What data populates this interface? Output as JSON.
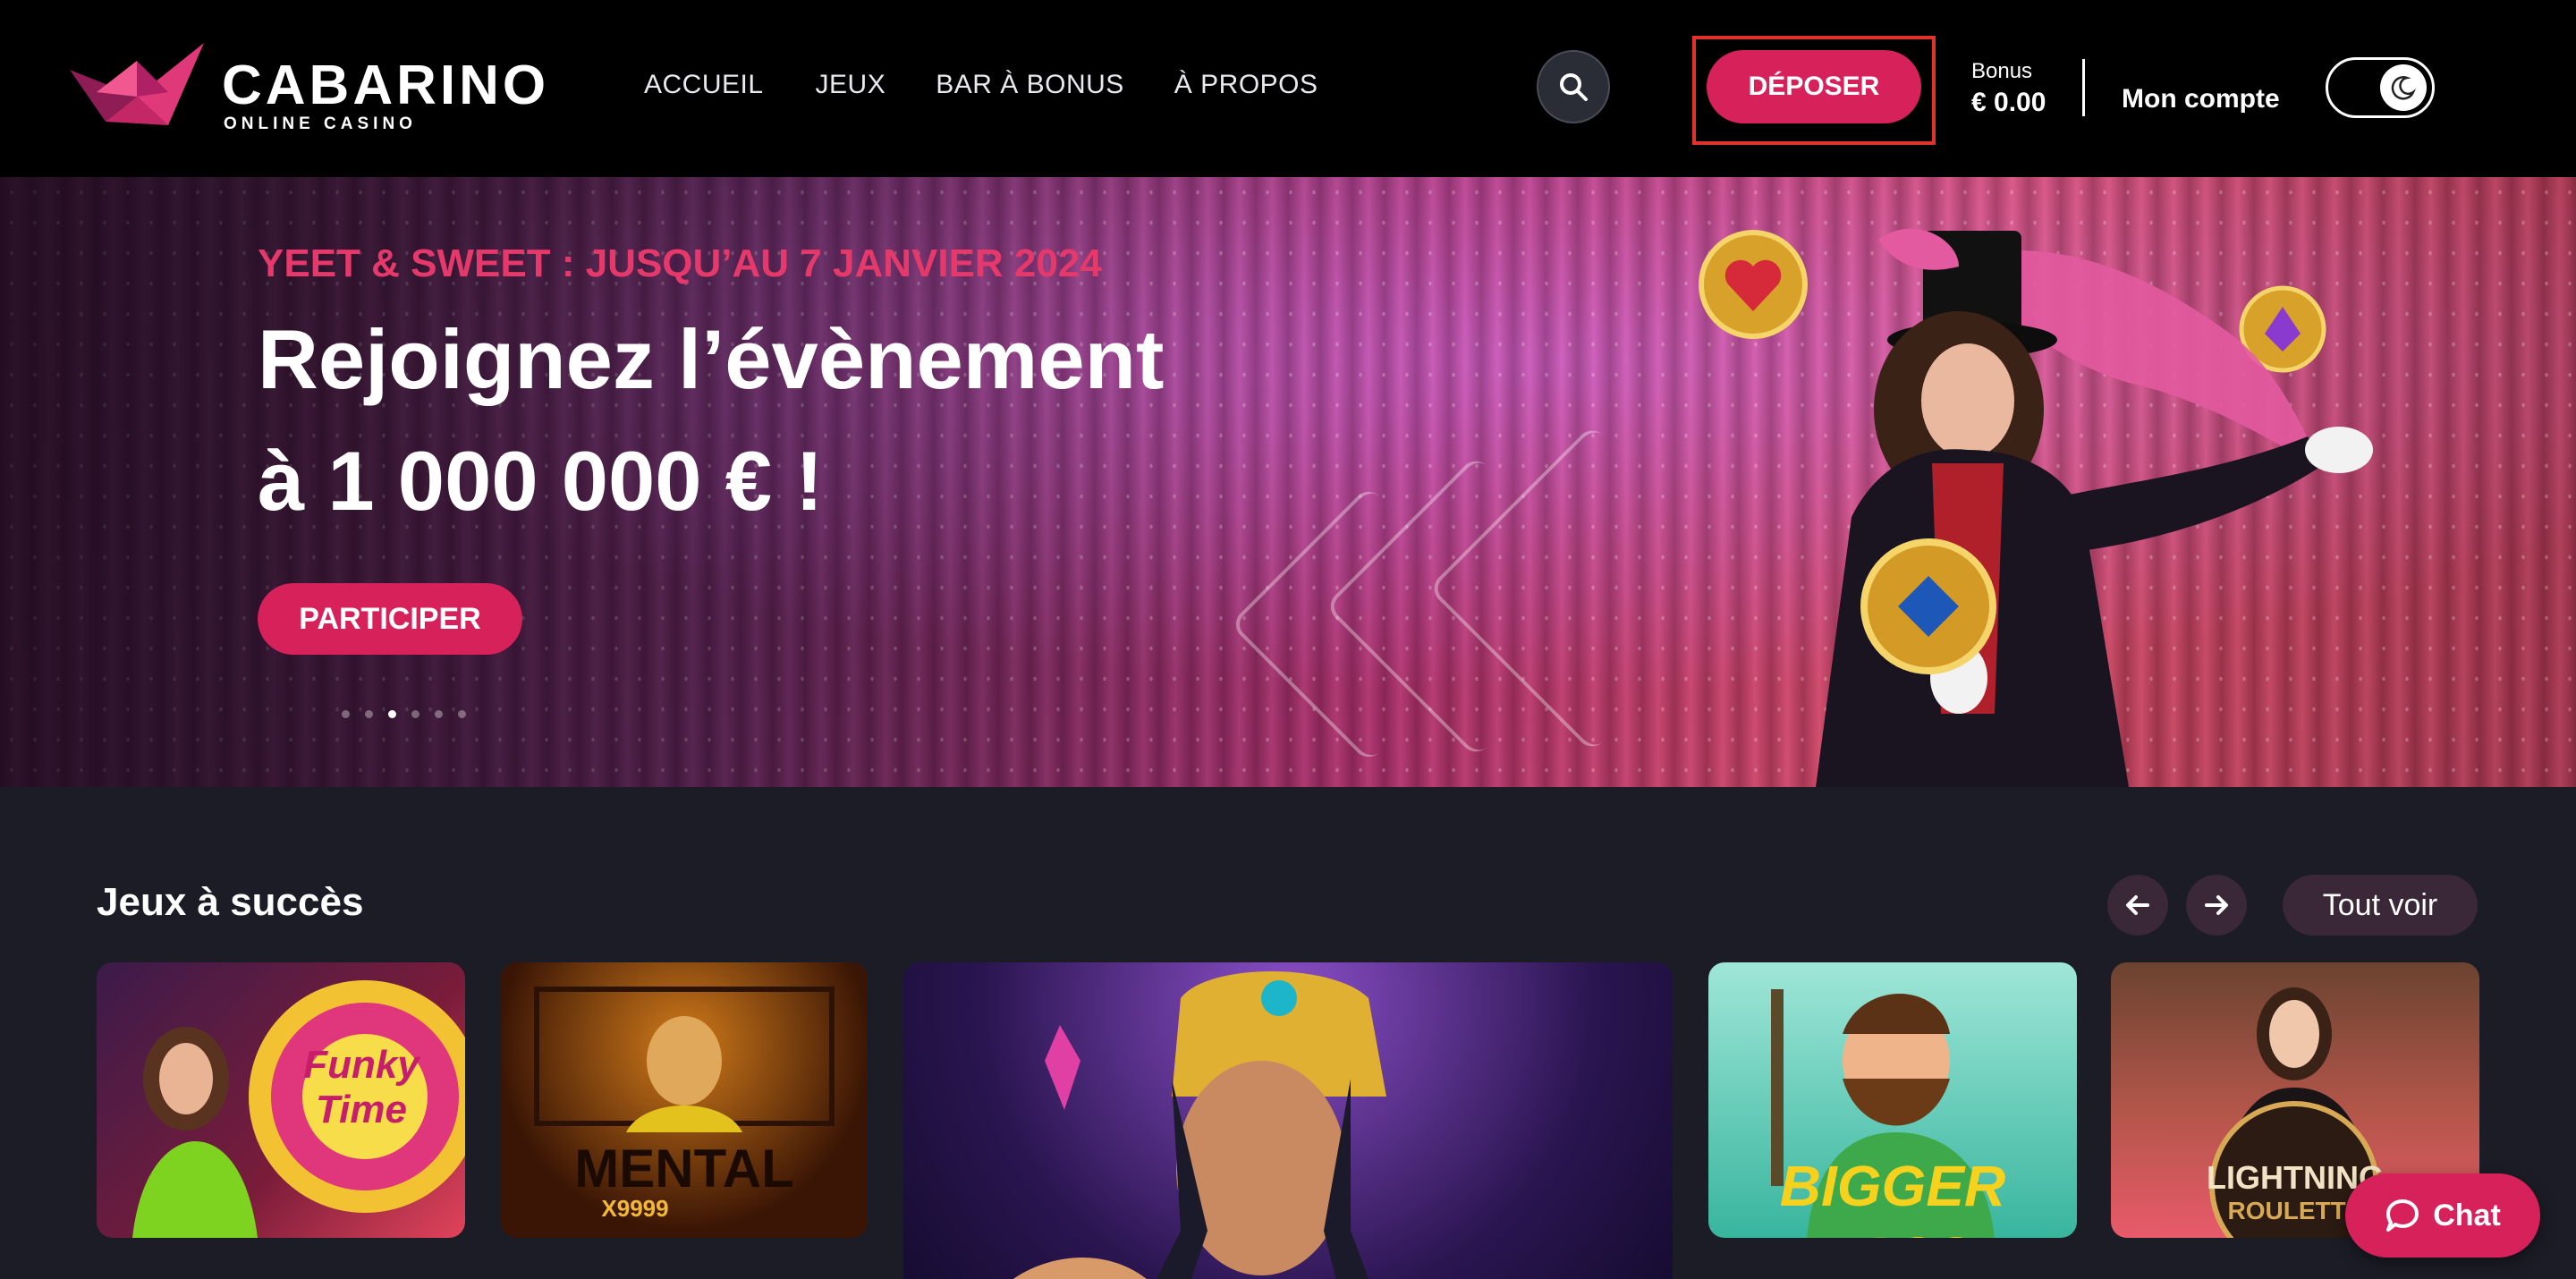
{
  "brand": {
    "name": "CABARINO",
    "tagline": "ONLINE CASINO"
  },
  "nav": {
    "items": [
      {
        "label": "ACCUEIL"
      },
      {
        "label": "JEUX"
      },
      {
        "label": "BAR À BONUS"
      },
      {
        "label": "À PROPOS"
      }
    ]
  },
  "header": {
    "deposit_label": "DÉPOSER",
    "bonus_label": "Bonus",
    "bonus_value": "€ 0.00",
    "account_label": "Mon compte",
    "search_icon": "search-icon",
    "theme_icon": "moon-icon"
  },
  "hero": {
    "tag": "YEET & SWEET : JUSQU’AU 7 JANVIER 2024",
    "title_line1": "Rejoignez l’évènement",
    "title_line2": "à 1 000 000 € !",
    "cta_label": "PARTICIPER",
    "slides_count": 6,
    "active_slide": 3
  },
  "games": {
    "section_title": "Jeux à succès",
    "see_all_label": "Tout voir",
    "prev_icon": "arrow-left-icon",
    "next_icon": "arrow-right-icon",
    "tiles": [
      {
        "title": "Funky Time"
      },
      {
        "title": "MENTAL",
        "subtitle": "X9999"
      },
      {
        "title": ""
      },
      {
        "title": "BIGGER BASS"
      },
      {
        "title": "LIGHTNING",
        "subtitle": "ROULETTE"
      }
    ]
  },
  "chat": {
    "label": "Chat",
    "icon": "chat-bubble-icon"
  },
  "colors": {
    "accent": "#d6215a",
    "header_bg": "#000000",
    "page_bg": "#1b1c25",
    "highlight_frame": "#e0312a",
    "hero_tag": "#e5396b"
  }
}
